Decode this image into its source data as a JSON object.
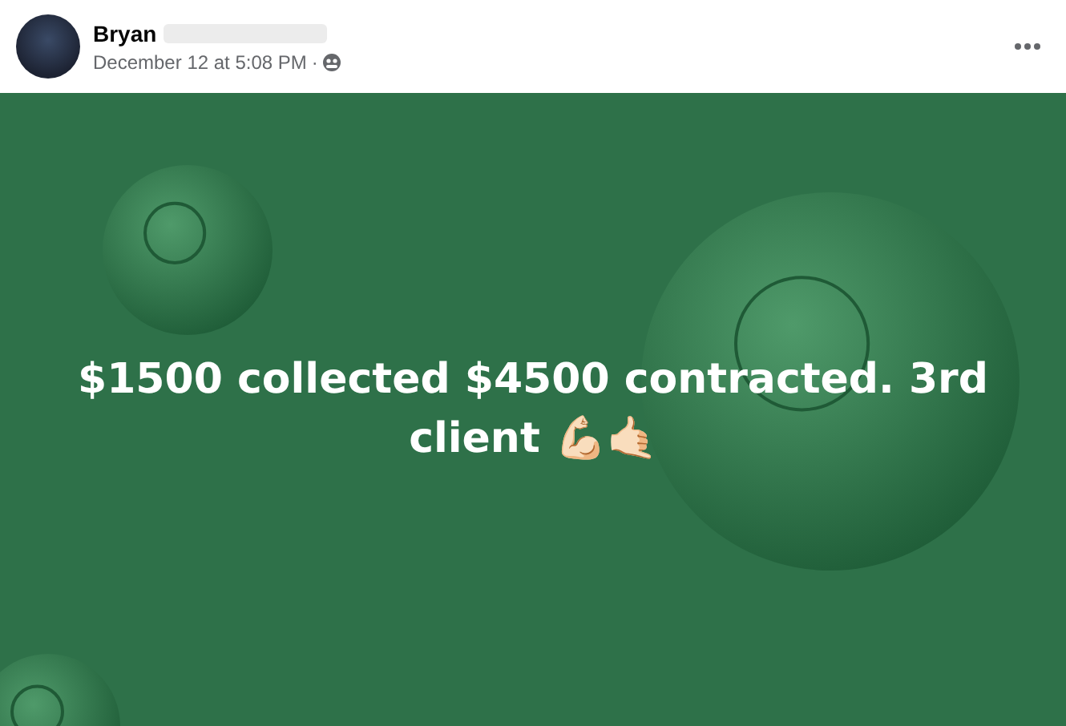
{
  "post": {
    "author": "Bryan",
    "timestamp": "December 12 at 5:08 PM",
    "separator": "·"
  },
  "background_post": {
    "text": "$1500 collected $4500 contracted. 3rd client 💪🏻🤙🏻"
  }
}
